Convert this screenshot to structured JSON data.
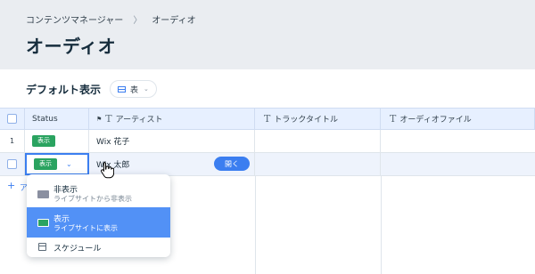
{
  "breadcrumb": {
    "parent": "コンテンツマネージャー",
    "current": "オーディオ"
  },
  "page_title": "オーディオ",
  "view": {
    "title": "デフォルト表示",
    "selector_label": "表"
  },
  "columns": {
    "status": "Status",
    "artist": "アーティスト",
    "track_title": "トラックタイトル",
    "audio_file": "オーディオファイル"
  },
  "rows": [
    {
      "num": "1",
      "status": "表示",
      "artist": "Wix 花子"
    },
    {
      "num": "",
      "status": "表示",
      "artist": "Wix 太郎",
      "open_label": "開く"
    }
  ],
  "add_row_label": "ア",
  "status_dropdown": {
    "options": [
      {
        "label": "非表示",
        "sub": "ライブサイトから非表示",
        "color": "#8a8fa0"
      },
      {
        "label": "表示",
        "sub": "ライブサイトに表示",
        "color": "#2aa360",
        "selected": true
      },
      {
        "label": "スケジュール"
      }
    ]
  },
  "colors": {
    "accent": "#3b7ef0",
    "status_green": "#2aa360",
    "header_bg": "#eaedf1"
  }
}
